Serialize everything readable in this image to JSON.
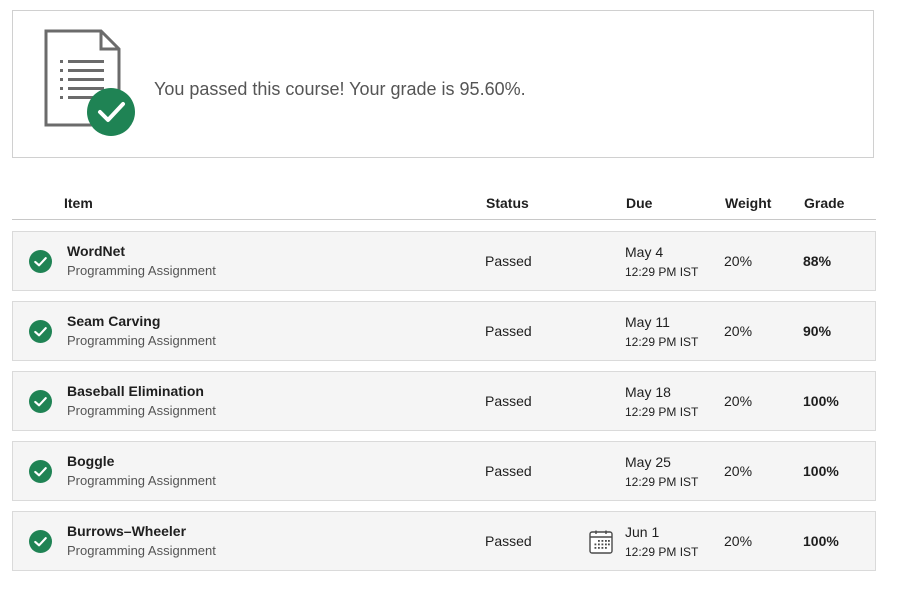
{
  "banner": {
    "icon": "document-check-icon",
    "message": "You passed this course! Your grade is 95.60%."
  },
  "table": {
    "headers": {
      "item": "Item",
      "status": "Status",
      "due": "Due",
      "weight": "Weight",
      "grade": "Grade"
    },
    "rows": [
      {
        "name": "WordNet",
        "type": "Programming Assignment",
        "status": "Passed",
        "due_date": "May 4",
        "due_time": "12:29 PM IST",
        "weight": "20%",
        "grade": "88%"
      },
      {
        "name": "Seam Carving",
        "type": "Programming Assignment",
        "status": "Passed",
        "due_date": "May 11",
        "due_time": "12:29 PM IST",
        "weight": "20%",
        "grade": "90%"
      },
      {
        "name": "Baseball Elimination",
        "type": "Programming Assignment",
        "status": "Passed",
        "due_date": "May 18",
        "due_time": "12:29 PM IST",
        "weight": "20%",
        "grade": "100%"
      },
      {
        "name": "Boggle",
        "type": "Programming Assignment",
        "status": "Passed",
        "due_date": "May 25",
        "due_time": "12:29 PM IST",
        "weight": "20%",
        "grade": "100%"
      },
      {
        "name": "Burrows–Wheeler",
        "type": "Programming Assignment",
        "status": "Passed",
        "due_date": "Jun 1",
        "due_time": "12:29 PM IST",
        "weight": "20%",
        "grade": "100%"
      }
    ]
  },
  "colors": {
    "success": "#1f8354",
    "row_bg": "#f5f5f5",
    "border": "#dadada"
  }
}
